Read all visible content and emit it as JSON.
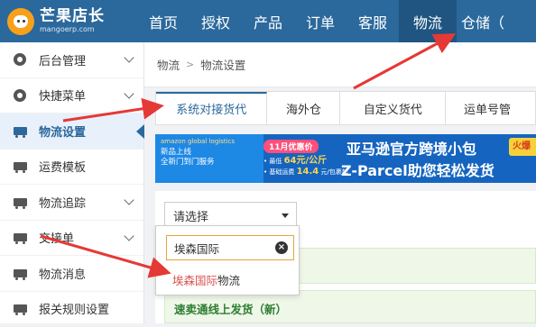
{
  "app": {
    "logo_name": "芒果店长",
    "logo_sub": "mangoerp.com"
  },
  "nav": {
    "items": [
      "首页",
      "授权",
      "产品",
      "订单",
      "客服",
      "物流",
      "仓储（"
    ],
    "active_index": 5,
    "active_bg": "#1f5580",
    "bar_color": "#2b689c"
  },
  "sidebar": {
    "items": [
      {
        "label": "后台管理",
        "icon": "gear-icon",
        "has_chevron": true
      },
      {
        "label": "快捷菜单",
        "icon": "shortcut-icon",
        "has_chevron": true
      },
      {
        "label": "物流设置",
        "icon": "truck-icon",
        "has_chevron": false,
        "active": true
      },
      {
        "label": "运费模板",
        "icon": "truck-icon",
        "has_chevron": false
      },
      {
        "label": "物流追踪",
        "icon": "truck-icon",
        "has_chevron": true
      },
      {
        "label": "交接单",
        "icon": "truck-icon",
        "has_chevron": true
      },
      {
        "label": "物流消息",
        "icon": "truck-icon",
        "has_chevron": false
      },
      {
        "label": "报关规则设置",
        "icon": "truck-icon",
        "has_chevron": false
      }
    ]
  },
  "breadcrumb": {
    "root": "物流",
    "separator": ">",
    "current": "物流设置"
  },
  "tabs": {
    "items": [
      "系统对接货代",
      "海外仓",
      "自定义货代",
      "运单号管"
    ],
    "active_index": 0
  },
  "banner": {
    "brand": "amazon global logistics",
    "line1": "新品上线",
    "line2": "全新门到门服务",
    "promo_tag": "11月优惠价",
    "promo_line1_prefix": "• 最低",
    "promo_price1": "64元/公斤",
    "promo_line2_prefix": "• 基础运费",
    "promo_price2": "14.4",
    "promo_line2_suffix": "元/包裹起",
    "title1": "亚马逊官方跨境小包",
    "title2": "Z-Parcel助您轻松发货",
    "corner_tag": "火爆"
  },
  "panel": {
    "select_value": "请选择",
    "row2_label": "速卖通线上发货（新）"
  },
  "dropdown": {
    "search_value": "埃森国际",
    "clear_icon": "×",
    "option_highlight": "埃森国际",
    "option_rest": "物流",
    "highlight_color": "#d9534f"
  }
}
